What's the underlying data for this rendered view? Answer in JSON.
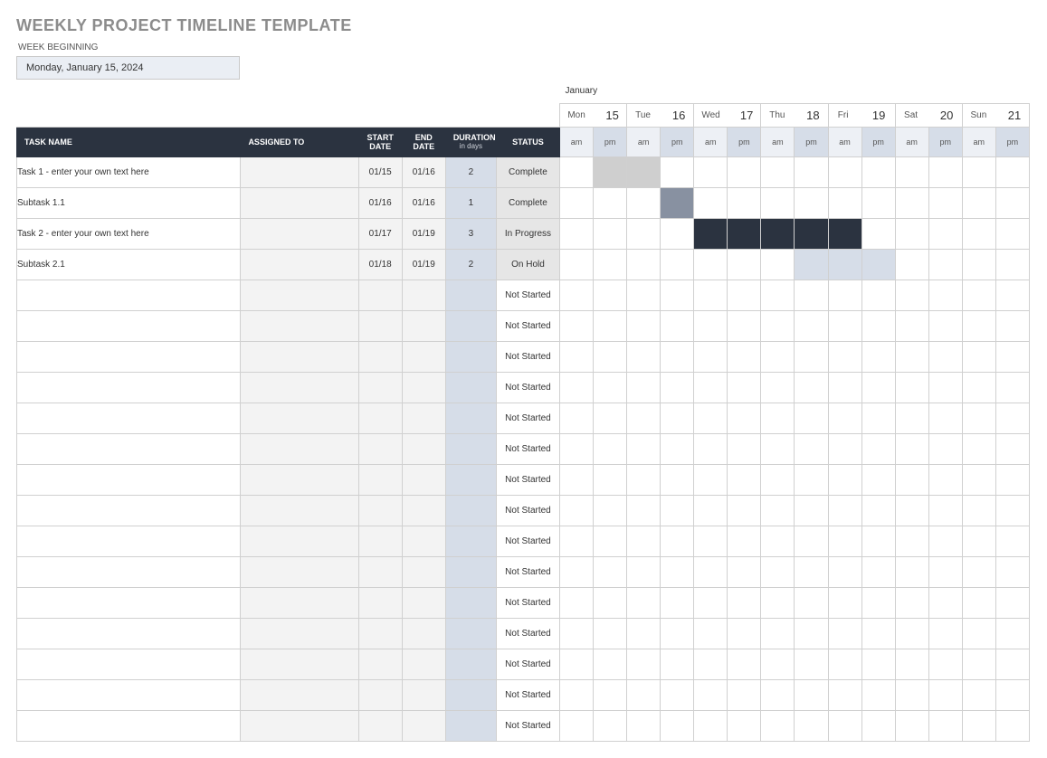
{
  "title": "WEEKLY PROJECT TIMELINE TEMPLATE",
  "week_beginning_label": "WEEK BEGINNING",
  "week_beginning_value": "Monday, January 15, 2024",
  "month": "January",
  "days": [
    {
      "dow": "Mon",
      "num": "15"
    },
    {
      "dow": "Tue",
      "num": "16"
    },
    {
      "dow": "Wed",
      "num": "17"
    },
    {
      "dow": "Thu",
      "num": "18"
    },
    {
      "dow": "Fri",
      "num": "19"
    },
    {
      "dow": "Sat",
      "num": "20"
    },
    {
      "dow": "Sun",
      "num": "21"
    }
  ],
  "ampm": {
    "am": "am",
    "pm": "pm"
  },
  "headers": {
    "task": "TASK NAME",
    "assigned": "ASSIGNED TO",
    "start": "START DATE",
    "end": "END DATE",
    "duration": "DURATION",
    "duration_sub": "in days",
    "status": "STATUS"
  },
  "rows": [
    {
      "task": "Task 1 - enter your own text here",
      "assigned": "",
      "start": "01/15",
      "end": "01/16",
      "duration": "2",
      "status": "Complete",
      "gantt": [
        "",
        "fill-grey",
        "fill-grey",
        "",
        "",
        "",
        "",
        "",
        "",
        "",
        "",
        "",
        "",
        ""
      ]
    },
    {
      "task": "Subtask 1.1",
      "assigned": "",
      "start": "01/16",
      "end": "01/16",
      "duration": "1",
      "status": "Complete",
      "gantt": [
        "",
        "",
        "",
        "fill-slate",
        "",
        "",
        "",
        "",
        "",
        "",
        "",
        "",
        "",
        ""
      ]
    },
    {
      "task": "Task 2 - enter your own text here",
      "assigned": "",
      "start": "01/17",
      "end": "01/19",
      "duration": "3",
      "status": "In Progress",
      "gantt": [
        "",
        "",
        "",
        "",
        "fill-dark",
        "fill-dark",
        "fill-dark",
        "fill-dark",
        "fill-dark",
        "",
        "",
        "",
        "",
        ""
      ]
    },
    {
      "task": "Subtask 2.1",
      "assigned": "",
      "start": "01/18",
      "end": "01/19",
      "duration": "2",
      "status": "On Hold",
      "gantt": [
        "",
        "",
        "",
        "",
        "",
        "",
        "",
        "fill-light",
        "fill-light",
        "fill-light",
        "",
        "",
        "",
        ""
      ]
    },
    {
      "task": "",
      "assigned": "",
      "start": "",
      "end": "",
      "duration": "",
      "status": "Not Started",
      "gantt": [
        "",
        "",
        "",
        "",
        "",
        "",
        "",
        "",
        "",
        "",
        "",
        "",
        "",
        ""
      ]
    },
    {
      "task": "",
      "assigned": "",
      "start": "",
      "end": "",
      "duration": "",
      "status": "Not Started",
      "gantt": [
        "",
        "",
        "",
        "",
        "",
        "",
        "",
        "",
        "",
        "",
        "",
        "",
        "",
        ""
      ]
    },
    {
      "task": "",
      "assigned": "",
      "start": "",
      "end": "",
      "duration": "",
      "status": "Not Started",
      "gantt": [
        "",
        "",
        "",
        "",
        "",
        "",
        "",
        "",
        "",
        "",
        "",
        "",
        "",
        ""
      ]
    },
    {
      "task": "",
      "assigned": "",
      "start": "",
      "end": "",
      "duration": "",
      "status": "Not Started",
      "gantt": [
        "",
        "",
        "",
        "",
        "",
        "",
        "",
        "",
        "",
        "",
        "",
        "",
        "",
        ""
      ]
    },
    {
      "task": "",
      "assigned": "",
      "start": "",
      "end": "",
      "duration": "",
      "status": "Not Started",
      "gantt": [
        "",
        "",
        "",
        "",
        "",
        "",
        "",
        "",
        "",
        "",
        "",
        "",
        "",
        ""
      ]
    },
    {
      "task": "",
      "assigned": "",
      "start": "",
      "end": "",
      "duration": "",
      "status": "Not Started",
      "gantt": [
        "",
        "",
        "",
        "",
        "",
        "",
        "",
        "",
        "",
        "",
        "",
        "",
        "",
        ""
      ]
    },
    {
      "task": "",
      "assigned": "",
      "start": "",
      "end": "",
      "duration": "",
      "status": "Not Started",
      "gantt": [
        "",
        "",
        "",
        "",
        "",
        "",
        "",
        "",
        "",
        "",
        "",
        "",
        "",
        ""
      ]
    },
    {
      "task": "",
      "assigned": "",
      "start": "",
      "end": "",
      "duration": "",
      "status": "Not Started",
      "gantt": [
        "",
        "",
        "",
        "",
        "",
        "",
        "",
        "",
        "",
        "",
        "",
        "",
        "",
        ""
      ]
    },
    {
      "task": "",
      "assigned": "",
      "start": "",
      "end": "",
      "duration": "",
      "status": "Not Started",
      "gantt": [
        "",
        "",
        "",
        "",
        "",
        "",
        "",
        "",
        "",
        "",
        "",
        "",
        "",
        ""
      ]
    },
    {
      "task": "",
      "assigned": "",
      "start": "",
      "end": "",
      "duration": "",
      "status": "Not Started",
      "gantt": [
        "",
        "",
        "",
        "",
        "",
        "",
        "",
        "",
        "",
        "",
        "",
        "",
        "",
        ""
      ]
    },
    {
      "task": "",
      "assigned": "",
      "start": "",
      "end": "",
      "duration": "",
      "status": "Not Started",
      "gantt": [
        "",
        "",
        "",
        "",
        "",
        "",
        "",
        "",
        "",
        "",
        "",
        "",
        "",
        ""
      ]
    },
    {
      "task": "",
      "assigned": "",
      "start": "",
      "end": "",
      "duration": "",
      "status": "Not Started",
      "gantt": [
        "",
        "",
        "",
        "",
        "",
        "",
        "",
        "",
        "",
        "",
        "",
        "",
        "",
        ""
      ]
    },
    {
      "task": "",
      "assigned": "",
      "start": "",
      "end": "",
      "duration": "",
      "status": "Not Started",
      "gantt": [
        "",
        "",
        "",
        "",
        "",
        "",
        "",
        "",
        "",
        "",
        "",
        "",
        "",
        ""
      ]
    },
    {
      "task": "",
      "assigned": "",
      "start": "",
      "end": "",
      "duration": "",
      "status": "Not Started",
      "gantt": [
        "",
        "",
        "",
        "",
        "",
        "",
        "",
        "",
        "",
        "",
        "",
        "",
        "",
        ""
      ]
    },
    {
      "task": "",
      "assigned": "",
      "start": "",
      "end": "",
      "duration": "",
      "status": "Not Started",
      "gantt": [
        "",
        "",
        "",
        "",
        "",
        "",
        "",
        "",
        "",
        "",
        "",
        "",
        "",
        ""
      ]
    }
  ]
}
